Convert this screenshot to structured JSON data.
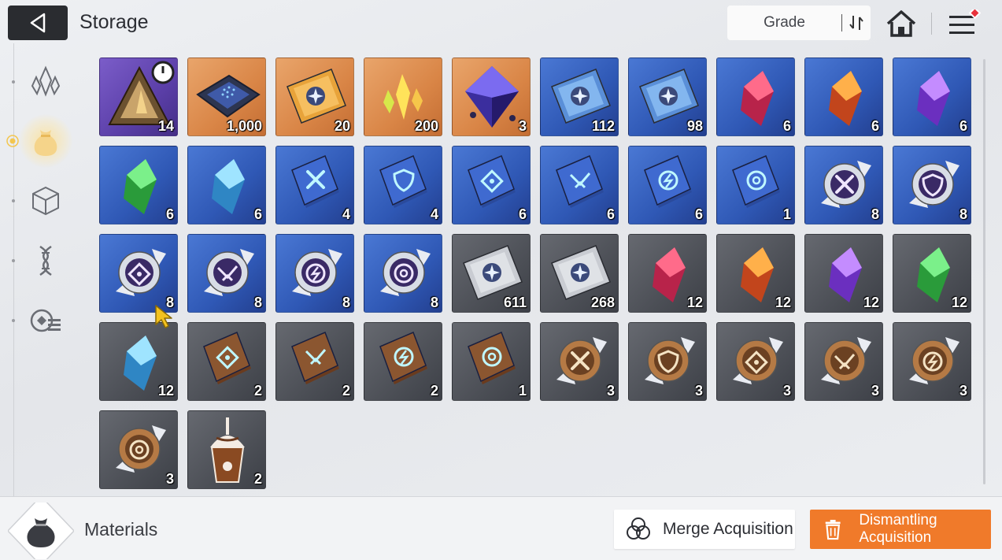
{
  "header": {
    "title": "Storage",
    "grade_label": "Grade",
    "back_icon": "back-arrow-icon",
    "sort_icon": "sort-arrows-icon",
    "home_icon": "home-icon",
    "menu_icon": "menu-icon",
    "menu_badge_color": "#e8323c"
  },
  "sidebar": {
    "items": [
      {
        "id": "crystal",
        "icon": "crystal-cluster-icon",
        "active": false
      },
      {
        "id": "materials",
        "icon": "pouch-icon",
        "active": true
      },
      {
        "id": "box",
        "icon": "cube-icon",
        "active": false
      },
      {
        "id": "dna",
        "icon": "dna-icon",
        "active": false
      },
      {
        "id": "misc",
        "icon": "gear-list-icon",
        "active": false
      }
    ]
  },
  "colors": {
    "rarity_purple": "#5b3fa8",
    "rarity_orange": "#d98546",
    "rarity_blue": "#2f58b5",
    "rarity_gray": "#4d5057",
    "accent_orange": "#f07a2a"
  },
  "items": [
    {
      "icon": "triangle-token-icon",
      "rarity": "purple",
      "qty": "14",
      "timer": true
    },
    {
      "icon": "chip-icon",
      "rarity": "orange",
      "qty": "1,000"
    },
    {
      "icon": "gold-ticket-icon",
      "rarity": "orange",
      "qty": "20"
    },
    {
      "icon": "gold-shard-icon",
      "rarity": "orange",
      "qty": "200"
    },
    {
      "icon": "prism-cube-icon",
      "rarity": "orange",
      "qty": "3"
    },
    {
      "icon": "blue-ticket-icon",
      "rarity": "blue",
      "qty": "112"
    },
    {
      "icon": "compass-ticket-icon",
      "rarity": "blue",
      "qty": "98"
    },
    {
      "icon": "red-crystal-icon",
      "rarity": "blue",
      "qty": "6"
    },
    {
      "icon": "orange-crystal-icon",
      "rarity": "blue",
      "qty": "6"
    },
    {
      "icon": "purple-crystal-icon",
      "rarity": "blue",
      "qty": "6"
    },
    {
      "icon": "green-crystal-icon",
      "rarity": "blue",
      "qty": "6"
    },
    {
      "icon": "cyan-crystal-icon",
      "rarity": "blue",
      "qty": "6"
    },
    {
      "icon": "sword-book-icon",
      "rarity": "blue",
      "qty": "4"
    },
    {
      "icon": "shield-book-icon",
      "rarity": "blue",
      "qty": "4"
    },
    {
      "icon": "target-book-icon",
      "rarity": "blue",
      "qty": "6"
    },
    {
      "icon": "wing-book-icon",
      "rarity": "blue",
      "qty": "6"
    },
    {
      "icon": "bolt-book-icon",
      "rarity": "blue",
      "qty": "6"
    },
    {
      "icon": "orb-book-icon",
      "rarity": "blue",
      "qty": "1"
    },
    {
      "icon": "sword-medal-icon",
      "rarity": "blue",
      "qty": "8"
    },
    {
      "icon": "shield-medal-icon",
      "rarity": "blue",
      "qty": "8"
    },
    {
      "icon": "target-medal-icon",
      "rarity": "blue",
      "qty": "8"
    },
    {
      "icon": "wing-medal-icon",
      "rarity": "blue",
      "qty": "8"
    },
    {
      "icon": "bolt-medal-icon",
      "rarity": "blue",
      "qty": "8"
    },
    {
      "icon": "orb-medal-icon",
      "rarity": "blue",
      "qty": "8"
    },
    {
      "icon": "silver-ticket-icon",
      "rarity": "gray",
      "qty": "611"
    },
    {
      "icon": "silver-compass-ticket-icon",
      "rarity": "gray",
      "qty": "268"
    },
    {
      "icon": "red-crystal-icon",
      "rarity": "gray",
      "qty": "12"
    },
    {
      "icon": "orange-crystal-icon",
      "rarity": "gray",
      "qty": "12"
    },
    {
      "icon": "purple-crystal-icon",
      "rarity": "gray",
      "qty": "12"
    },
    {
      "icon": "green-crystal-icon",
      "rarity": "gray",
      "qty": "12"
    },
    {
      "icon": "cyan-crystal-icon",
      "rarity": "gray",
      "qty": "12"
    },
    {
      "icon": "target-brown-book-icon",
      "rarity": "gray",
      "qty": "2"
    },
    {
      "icon": "wing-brown-book-icon",
      "rarity": "gray",
      "qty": "2"
    },
    {
      "icon": "bolt-brown-book-icon",
      "rarity": "gray",
      "qty": "2"
    },
    {
      "icon": "orb-brown-book-icon",
      "rarity": "gray",
      "qty": "1"
    },
    {
      "icon": "sword-bronze-medal-icon",
      "rarity": "gray",
      "qty": "3"
    },
    {
      "icon": "shield-bronze-medal-icon",
      "rarity": "gray",
      "qty": "3"
    },
    {
      "icon": "target-bronze-medal-icon",
      "rarity": "gray",
      "qty": "3"
    },
    {
      "icon": "wing-bronze-medal-icon",
      "rarity": "gray",
      "qty": "3"
    },
    {
      "icon": "bolt-bronze-medal-icon",
      "rarity": "gray",
      "qty": "3"
    },
    {
      "icon": "orb-bronze-medal-icon",
      "rarity": "gray",
      "qty": "3"
    },
    {
      "icon": "frappe-drink-icon",
      "rarity": "gray",
      "qty": "2"
    }
  ],
  "footer": {
    "category_label": "Materials",
    "category_icon": "pouch-icon",
    "merge_label": "Merge Acquisition",
    "merge_icon": "trefoil-icon",
    "dismantle_label": "Dismantling Acquisition",
    "dismantle_icon": "trash-icon"
  }
}
